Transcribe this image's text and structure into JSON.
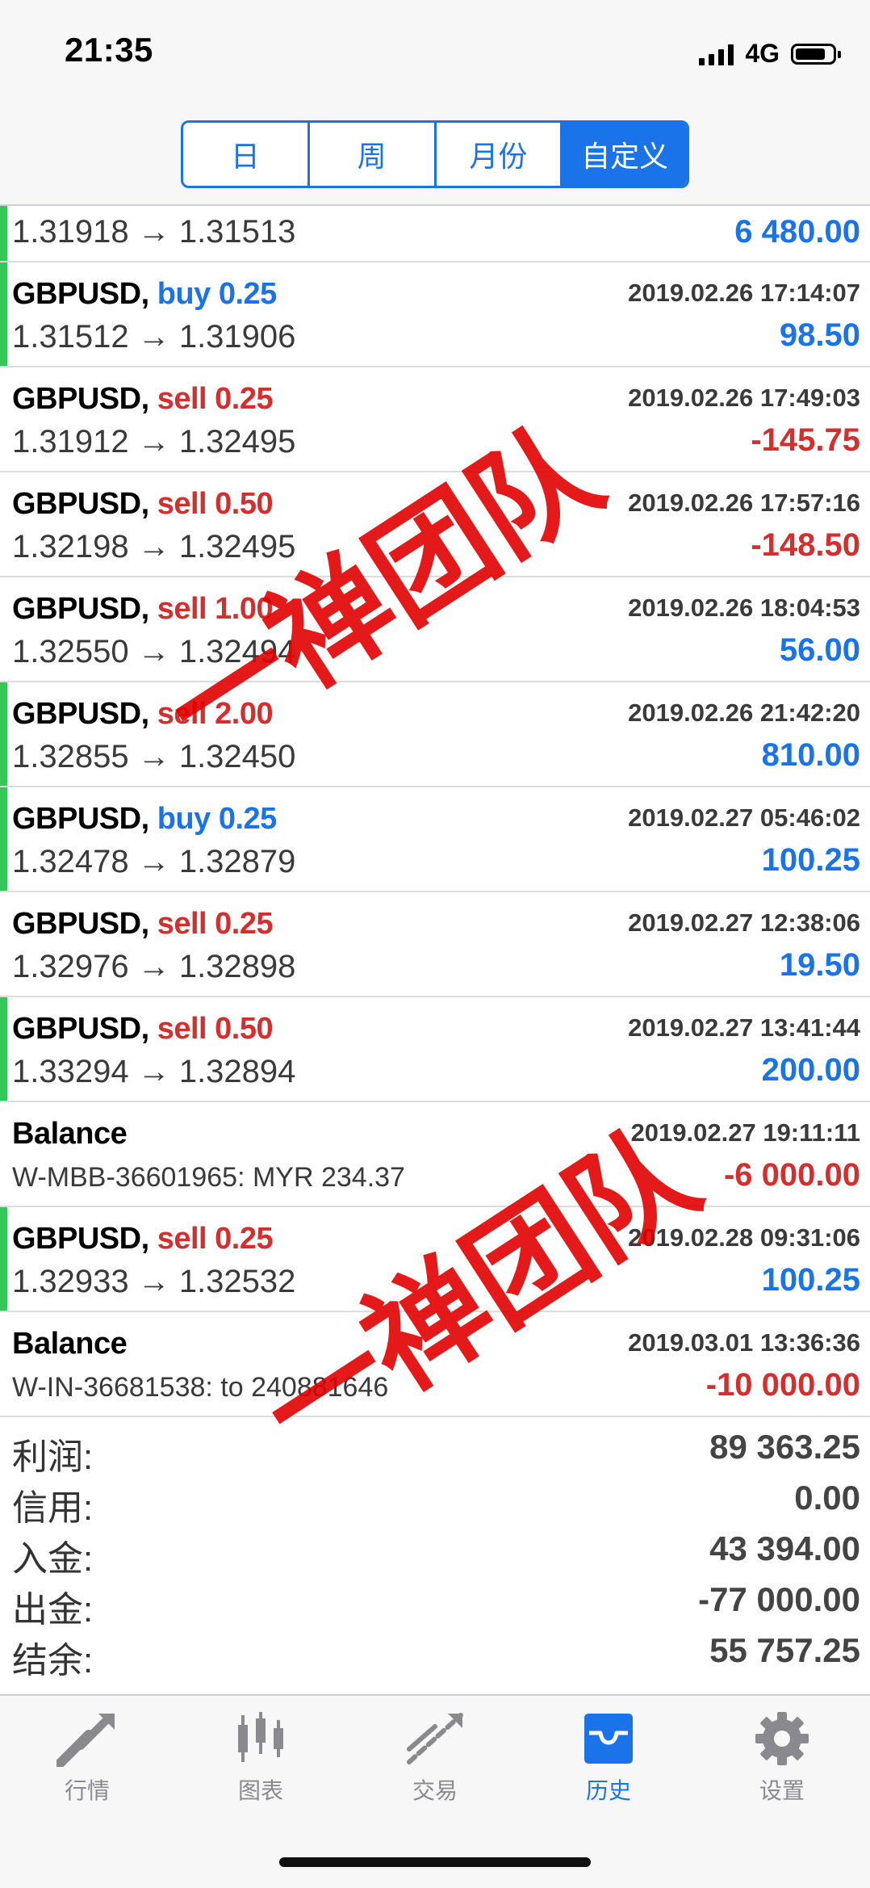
{
  "status": {
    "time": "21:35",
    "network": "4G"
  },
  "segments": [
    {
      "label": "日",
      "active": false
    },
    {
      "label": "周",
      "active": false
    },
    {
      "label": "月份",
      "active": false
    },
    {
      "label": "自定义",
      "active": true
    }
  ],
  "first_row": {
    "prices": "1.31918 → 1.31513",
    "profit": "6 480.00"
  },
  "rows": [
    {
      "symbol": "GBPUSD,",
      "side": "buy 0.25",
      "date": "2019.02.26 17:14:07",
      "prices": "1.31512 → 1.31906",
      "profit": "98.50"
    },
    {
      "symbol": "GBPUSD,",
      "side": "sell 0.25",
      "date": "2019.02.26 17:49:03",
      "prices": "1.31912 → 1.32495",
      "profit": "-145.75"
    },
    {
      "symbol": "GBPUSD,",
      "side": "sell 0.50",
      "date": "2019.02.26 17:57:16",
      "prices": "1.32198 → 1.32495",
      "profit": "-148.50"
    },
    {
      "symbol": "GBPUSD,",
      "side": "sell 1.00",
      "date": "2019.02.26 18:04:53",
      "prices": "1.32550 → 1.32494",
      "profit": "56.00"
    },
    {
      "symbol": "GBPUSD,",
      "side": "sell 2.00",
      "date": "2019.02.26 21:42:20",
      "prices": "1.32855 → 1.32450",
      "profit": "810.00"
    },
    {
      "symbol": "GBPUSD,",
      "side": "buy 0.25",
      "date": "2019.02.27 05:46:02",
      "prices": "1.32478 → 1.32879",
      "profit": "100.25"
    },
    {
      "symbol": "GBPUSD,",
      "side": "sell 0.25",
      "date": "2019.02.27 12:38:06",
      "prices": "1.32976 → 1.32898",
      "profit": "19.50"
    },
    {
      "symbol": "GBPUSD,",
      "side": "sell 0.50",
      "date": "2019.02.27 13:41:44",
      "prices": "1.33294 → 1.32894",
      "profit": "200.00"
    },
    {
      "symbol": "Balance",
      "side": "",
      "date": "2019.02.27 19:11:11",
      "comment": "W-MBB-36601965: MYR 234.37",
      "profit": "-6 000.00"
    },
    {
      "symbol": "GBPUSD,",
      "side": "sell 0.25",
      "date": "2019.02.28 09:31:06",
      "prices": "1.32933 → 1.32532",
      "profit": "100.25"
    },
    {
      "symbol": "Balance",
      "side": "",
      "date": "2019.03.01 13:36:36",
      "comment": "W-IN-36681538: to 240881646",
      "profit": "-10 000.00"
    }
  ],
  "summary": [
    {
      "label": "利润:",
      "value": "89 363.25"
    },
    {
      "label": "信用:",
      "value": "0.00"
    },
    {
      "label": "入金:",
      "value": "43 394.00"
    },
    {
      "label": "出金:",
      "value": "-77 000.00"
    },
    {
      "label": "结余:",
      "value": "55 757.25"
    }
  ],
  "tabs": [
    {
      "label": "行情",
      "icon": "quotes-icon",
      "active": false
    },
    {
      "label": "图表",
      "icon": "chart-icon",
      "active": false
    },
    {
      "label": "交易",
      "icon": "trade-icon",
      "active": false
    },
    {
      "label": "历史",
      "icon": "history-icon",
      "active": true
    },
    {
      "label": "设置",
      "icon": "settings-icon",
      "active": false
    }
  ],
  "watermark": "一禅团队",
  "colors": {
    "accent": "#1a73e8",
    "loss": "#d32f2f",
    "gain_marker": "#34c759",
    "watermark": "#e10000"
  }
}
